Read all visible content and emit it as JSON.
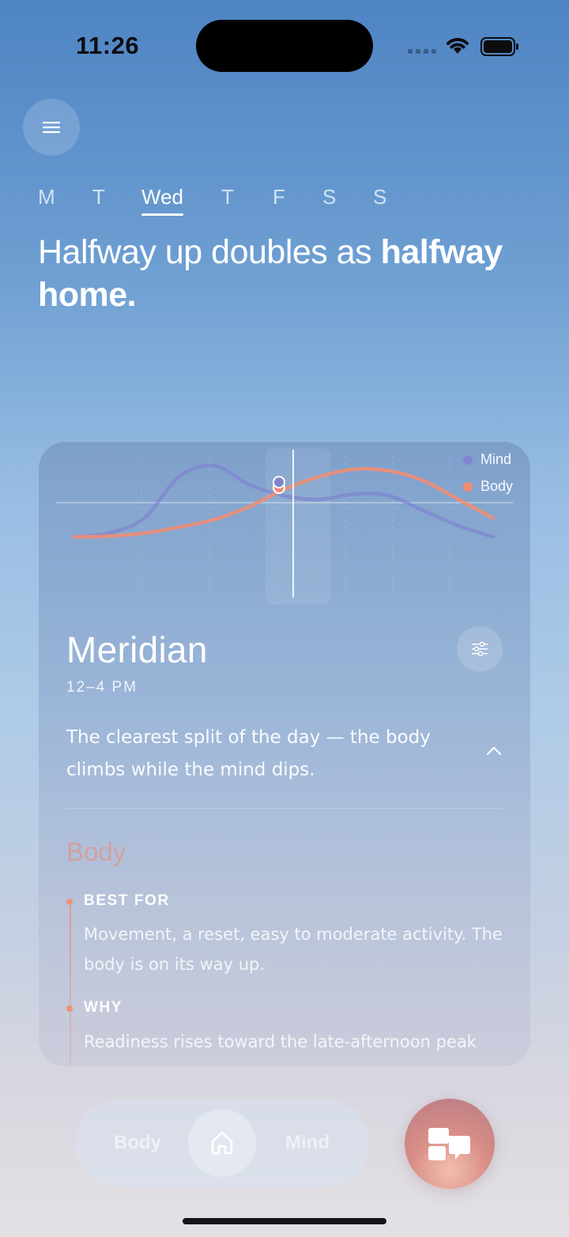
{
  "status": {
    "time": "11:26"
  },
  "days": [
    {
      "label": "M",
      "active": false
    },
    {
      "label": "T",
      "active": false
    },
    {
      "label": "Wed",
      "active": true
    },
    {
      "label": "T",
      "active": false
    },
    {
      "label": "F",
      "active": false
    },
    {
      "label": "S",
      "active": false
    },
    {
      "label": "S",
      "active": false
    }
  ],
  "headline": {
    "regular": "Halfway up doubles as ",
    "bold": "halfway home."
  },
  "card": {
    "title": "Meridian",
    "time": "12–4 PM",
    "description": "The clearest split of the day — the body climbs while the mind dips.",
    "section_title": "Body",
    "items": [
      {
        "label": "BEST FOR",
        "text": "Movement, a reset, easy to moderate activity. The body is on its way up."
      },
      {
        "label": "WHY",
        "text": "Readiness rises toward the late-afternoon peak"
      }
    ]
  },
  "chart_data": {
    "type": "line",
    "series": [
      {
        "name": "Mind",
        "color": "#7f86cf",
        "values": [
          0.05,
          0.1,
          0.3,
          0.85,
          1.0,
          0.75,
          0.6,
          0.55,
          0.62,
          0.6,
          0.4,
          0.2,
          0.05
        ]
      },
      {
        "name": "Body",
        "color": "#ee8e76",
        "values": [
          0.05,
          0.06,
          0.1,
          0.18,
          0.28,
          0.45,
          0.68,
          0.85,
          0.95,
          0.93,
          0.8,
          0.55,
          0.3
        ]
      }
    ],
    "highlight_index": 6,
    "ylim": [
      0,
      1
    ],
    "grid": true,
    "legend": "top-right"
  },
  "tabbar": {
    "left_label": "Body",
    "right_label": "Mind"
  },
  "colors": {
    "body": "#ee8e76",
    "mind": "#7f86cf"
  },
  "icons": {
    "menu": "hamburger-icon",
    "settings": "sliders-icon",
    "collapse": "chevron-up-icon",
    "home": "home-icon",
    "chat": "chat-bubbles-icon"
  }
}
